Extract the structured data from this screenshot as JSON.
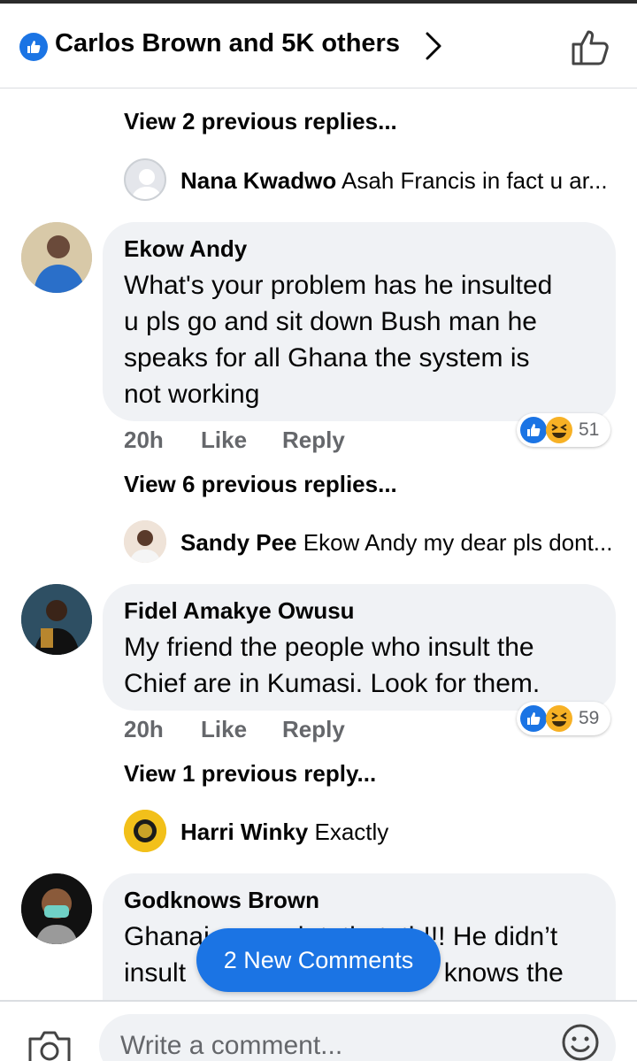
{
  "header": {
    "title": "Carlos Brown and 5K others",
    "icons": {
      "reactions_badge": "like-badge-icon",
      "chevron": "chevron-right-icon",
      "like": "thumbs-up-outline-icon"
    }
  },
  "colors": {
    "brand_blue": "#1b74e4",
    "bubble_bg": "#f0f2f5",
    "meta_gray": "#65676b"
  },
  "thread": [
    {
      "view_previous": "View 2 previous replies...",
      "reply": {
        "name": "Nana Kwadwo",
        "text": "Asah Francis  in fact u ar..."
      }
    },
    {
      "author": "Ekow Andy",
      "text": "What's your problem has he insulted\nu pls go and sit down Bush man he\nspeaks for all Ghana the system is\nnot working",
      "time": "20h",
      "like_label": "Like",
      "reply_label": "Reply",
      "reaction_count": "51",
      "view_previous": "View 6 previous replies...",
      "reply": {
        "name": "Sandy Pee",
        "text": "Ekow Andy my dear pls dont..."
      }
    },
    {
      "author": "Fidel Amakye Owusu",
      "text": "My friend the people who insult the\nChief are in Kumasi. Look for them.",
      "time": "20h",
      "like_label": "Like",
      "reply_label": "Reply",
      "reaction_count": "59",
      "view_previous": "View 1 previous reply...",
      "reply": {
        "name": "Harri Winky",
        "text": "Exactly"
      }
    },
    {
      "author": "Godknows Brown",
      "text_visible": "Ghanai            h t  th  t  th!!! He didn’t\ninsult                                   knows the"
    }
  ],
  "new_comments_label": "2 New Comments",
  "composer": {
    "placeholder": "Write a comment...",
    "icons": {
      "camera": "camera-icon",
      "emoji": "smiley-face-icon"
    }
  }
}
